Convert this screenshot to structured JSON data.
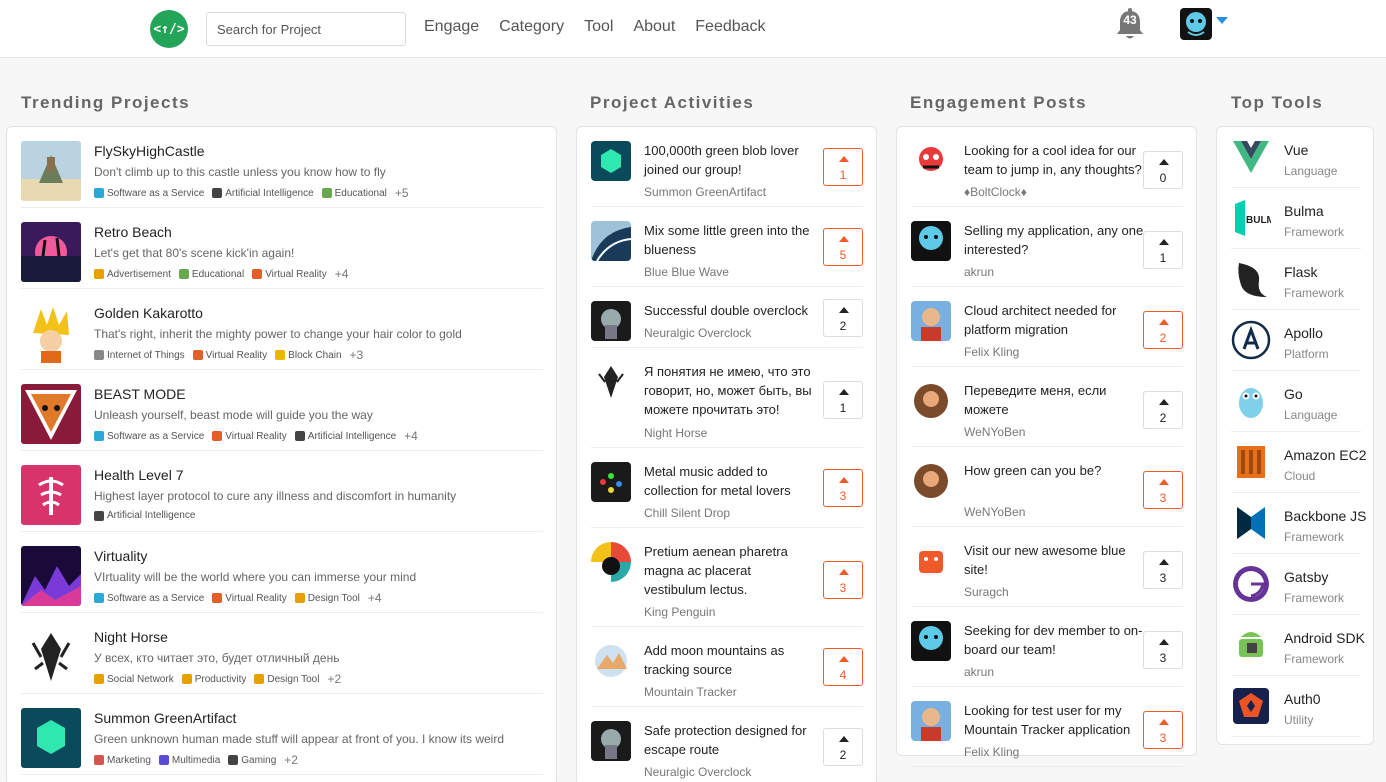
{
  "nav": {
    "logo_text": "<↑/>",
    "search_placeholder": "Search for Project",
    "links": [
      "Engage",
      "Category",
      "Tool",
      "About",
      "Feedback"
    ],
    "notification_count": "43"
  },
  "sections": {
    "trending": "Trending Projects",
    "activities": "Project Activities",
    "engagement": "Engagement Posts",
    "tools": "Top Tools"
  },
  "trending": [
    {
      "title": "FlySkyHighCastle",
      "desc": "Don't climb up to this castle unless you know how to fly",
      "tags": [
        {
          "label": "Software as a Service",
          "icon": "globe-icon",
          "color": "#2aa8d8"
        },
        {
          "label": "Artificial Intelligence",
          "icon": "robot-icon",
          "color": "#444"
        },
        {
          "label": "Educational",
          "icon": "book-icon",
          "color": "#6aa84f"
        }
      ],
      "more": "+5"
    },
    {
      "title": "Retro Beach",
      "desc": "Let's get that 80's scene kick'in again!",
      "tags": [
        {
          "label": "Advertisement",
          "icon": "megaphone-icon",
          "color": "#e6a100"
        },
        {
          "label": "Educational",
          "icon": "book-icon",
          "color": "#6aa84f"
        },
        {
          "label": "Virtual Reality",
          "icon": "rainbow-icon",
          "color": "#e0602a"
        }
      ],
      "more": "+4"
    },
    {
      "title": "Golden Kakarotto",
      "desc": "That's right, inherit the mighty power to change your hair color to gold",
      "tags": [
        {
          "label": "Internet of Things",
          "icon": "plug-icon",
          "color": "#888"
        },
        {
          "label": "Virtual Reality",
          "icon": "rainbow-icon",
          "color": "#e0602a"
        },
        {
          "label": "Block Chain",
          "icon": "coin-icon",
          "color": "#e6b800"
        }
      ],
      "more": "+3"
    },
    {
      "title": "BEAST MODE",
      "desc": "Unleash yourself, beast mode will guide you the way",
      "tags": [
        {
          "label": "Software as a Service",
          "icon": "globe-icon",
          "color": "#2aa8d8"
        },
        {
          "label": "Virtual Reality",
          "icon": "rainbow-icon",
          "color": "#e0602a"
        },
        {
          "label": "Artificial Intelligence",
          "icon": "robot-icon",
          "color": "#444"
        }
      ],
      "more": "+4"
    },
    {
      "title": "Health Level 7",
      "desc": "Highest layer protocol to cure any illness and discomfort in humanity",
      "tags": [
        {
          "label": "Artificial Intelligence",
          "icon": "robot-icon",
          "color": "#444"
        }
      ],
      "more": ""
    },
    {
      "title": "Virtuality",
      "desc": "VIrtuality will be the world where you can immerse your mind",
      "tags": [
        {
          "label": "Software as a Service",
          "icon": "globe-icon",
          "color": "#2aa8d8"
        },
        {
          "label": "Virtual Reality",
          "icon": "rainbow-icon",
          "color": "#e0602a"
        },
        {
          "label": "Design Tool",
          "icon": "palette-icon",
          "color": "#e6a100"
        }
      ],
      "more": "+4"
    },
    {
      "title": "Night Horse",
      "desc": "У всех, кто читает это, будет отличный день",
      "tags": [
        {
          "label": "Social Network",
          "icon": "people-icon",
          "color": "#e6a100"
        },
        {
          "label": "Productivity",
          "icon": "pencil-icon",
          "color": "#e6a100"
        },
        {
          "label": "Design Tool",
          "icon": "palette-icon",
          "color": "#e6a100"
        }
      ],
      "more": "+2"
    },
    {
      "title": "Summon GreenArtifact",
      "desc": "Green unknown human made stuff will appear at front of you. I know its weird",
      "tags": [
        {
          "label": "Marketing",
          "icon": "chart-icon",
          "color": "#d9534f"
        },
        {
          "label": "Multimedia",
          "icon": "music-icon",
          "color": "#5b4bd8"
        },
        {
          "label": "Gaming",
          "icon": "gamepad-icon",
          "color": "#444"
        }
      ],
      "more": "+2"
    }
  ],
  "activities": [
    {
      "title": "100,000th green blob lover joined our group!",
      "sub": "Summon GreenArtifact",
      "votes": "1",
      "hot": true
    },
    {
      "title": "Mix some little green into the blueness",
      "sub": "Blue Blue Wave",
      "votes": "5",
      "hot": true
    },
    {
      "title": "Successful double overclock",
      "sub": "Neuralgic Overclock",
      "votes": "2",
      "hot": false
    },
    {
      "title": "Я понятия не имею, что это говорит, но, может быть, вы можете прочитать это!",
      "sub": "Night Horse",
      "votes": "1",
      "hot": false
    },
    {
      "title": "Metal music added to collection for metal lovers",
      "sub": "Chill Silent Drop",
      "votes": "3",
      "hot": true
    },
    {
      "title": "Pretium aenean pharetra magna ac placerat vestibulum lectus.",
      "sub": "King Penguin",
      "votes": "3",
      "hot": true
    },
    {
      "title": "Add moon mountains as tracking source",
      "sub": "Mountain Tracker",
      "votes": "4",
      "hot": true
    },
    {
      "title": "Safe protection designed for escape route",
      "sub": "Neuralgic Overclock",
      "votes": "2",
      "hot": false
    }
  ],
  "engagement": [
    {
      "title": "Looking for a cool idea for our team to jump in, any thoughts?",
      "sub": "♦BoltClock♦",
      "votes": "0",
      "hot": false
    },
    {
      "title": "Selling my application, any one interested?",
      "sub": "akrun",
      "votes": "1",
      "hot": false
    },
    {
      "title": "Cloud architect needed for platform migration",
      "sub": "Felix Kling",
      "votes": "2",
      "hot": true
    },
    {
      "title": "Переведите меня, если можете",
      "sub": "WeNYoBen",
      "votes": "2",
      "hot": false
    },
    {
      "title": "How green can you be?",
      "sub": "WeNYoBen",
      "votes": "3",
      "hot": true
    },
    {
      "title": "Visit our new awesome blue site!",
      "sub": "Suragch",
      "votes": "3",
      "hot": false
    },
    {
      "title": "Seeking for dev member to on-board our team!",
      "sub": "akrun",
      "votes": "3",
      "hot": false
    },
    {
      "title": "Looking for test user for my Mountain Tracker application",
      "sub": "Felix Kling",
      "votes": "3",
      "hot": true
    }
  ],
  "tools": [
    {
      "name": "Vue",
      "type": "Language",
      "icon": "vue-icon"
    },
    {
      "name": "Bulma",
      "type": "Framework",
      "icon": "bulma-icon"
    },
    {
      "name": "Flask",
      "type": "Framework",
      "icon": "flask-icon"
    },
    {
      "name": "Apollo",
      "type": "Platform",
      "icon": "apollo-icon"
    },
    {
      "name": "Go",
      "type": "Language",
      "icon": "go-gopher-icon"
    },
    {
      "name": "Amazon EC2",
      "type": "Cloud",
      "icon": "amazon-ec2-icon"
    },
    {
      "name": "Backbone JS",
      "type": "Framework",
      "icon": "backbone-icon"
    },
    {
      "name": "Gatsby",
      "type": "Framework",
      "icon": "gatsby-icon"
    },
    {
      "name": "Android SDK",
      "type": "Framework",
      "icon": "android-icon"
    },
    {
      "name": "Auth0",
      "type": "Utility",
      "icon": "auth0-icon"
    }
  ],
  "colors": {
    "brand": "#23a559",
    "accent": "#ee5a2a",
    "caret": "#2a8fe0"
  }
}
